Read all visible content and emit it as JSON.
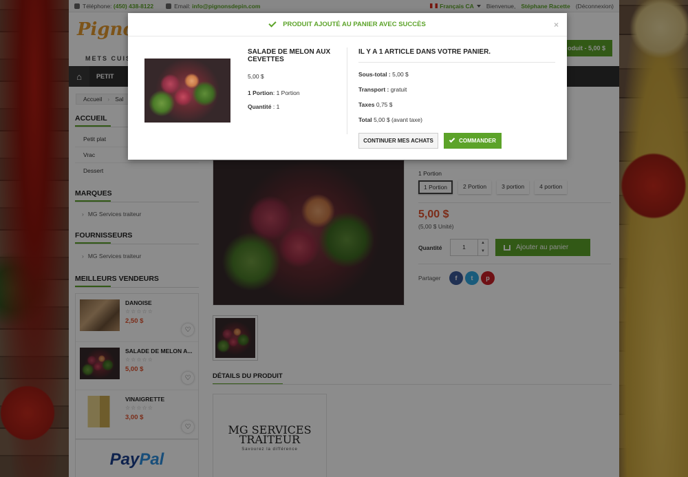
{
  "topbar": {
    "phone_label": "Téléphone:",
    "phone": "(450) 438-8122",
    "email_label": "Email:",
    "email": "info@pignonsdepin.com",
    "language": "Français CA",
    "welcome": "Bienvenue,",
    "user": "Stéphane Racette",
    "logout": "(Déconnexion)"
  },
  "header": {
    "logo": "Pignon",
    "logo_sub": "METS CUIS",
    "cart_button": "oduit - 5,00 $"
  },
  "nav": {
    "home_icon": "home-icon",
    "items": [
      "PETIT"
    ]
  },
  "breadcrumb": [
    "Accueil",
    "Sal"
  ],
  "sidebar": {
    "categories_title": "ACCUEIL",
    "categories": [
      "Petit plat",
      "Vrac",
      "Dessert"
    ],
    "brands_title": "MARQUES",
    "brands": [
      "MG Services traiteur"
    ],
    "suppliers_title": "FOURNISSEURS",
    "suppliers": [
      "MG Services traiteur"
    ],
    "bestsellers_title": "MEILLEURS VENDEURS",
    "bestsellers": [
      {
        "name": "DANOISE",
        "stars": "☆☆☆☆☆",
        "price": "2,50 $"
      },
      {
        "name": "SALADE DE MELON A...",
        "stars": "☆☆☆☆☆",
        "price": "5,00 $"
      },
      {
        "name": "VINAIGRETTE",
        "stars": "☆☆☆☆☆",
        "price": "3,00 $"
      }
    ],
    "paypal": [
      "Pay",
      "Pal"
    ]
  },
  "product": {
    "variant_label": "1 Portion",
    "variants": [
      "1 Portion",
      "2 Portion",
      "3 portion",
      "4 portion"
    ],
    "selected_variant": "1 Portion",
    "price": "5,00 $",
    "unit_price": "(5,00 $ Unité)",
    "quantity_label": "Quantité",
    "quantity": "1",
    "add_to_cart": "Ajouter au panier",
    "share_label": "Partager",
    "share": [
      {
        "name": "facebook",
        "glyph": "f",
        "color": "#3b5998"
      },
      {
        "name": "twitter",
        "glyph": "t",
        "color": "#2ea7e0"
      },
      {
        "name": "pinterest",
        "glyph": "p",
        "color": "#cb2027"
      }
    ],
    "details_title": "DÉTAILS DU PRODUIT",
    "brand_logo_name": "MG SERVICES TRAITEUR",
    "brand_logo_tag": "Savourez la différence"
  },
  "modal": {
    "title": "PRODUIT AJOUTÉ AU PANIER AVEC SUCCÈS",
    "close": "×",
    "product_name": "SALADE DE MELON AUX CEVETTES",
    "product_price": "5,00 $",
    "portion_label": "1 Portion",
    "portion_value": ": 1 Portion",
    "quantity_label": "Quantité",
    "quantity_value": ": 1",
    "cart_title": "IL Y A 1 ARTICLE DANS VOTRE PANIER.",
    "subtotal_label": "Sous-total :",
    "subtotal": "5,00 $",
    "shipping_label": "Transport :",
    "shipping": "gratuit",
    "taxes_label": "Taxes",
    "taxes": "0,75 $",
    "total_label": "Total",
    "total": "5,00 $ (avant taxe)",
    "continue_button": "CONTINUER MES ACHATS",
    "order_button": "COMMANDER"
  },
  "colors": {
    "accent": "#5ca329",
    "price": "#e0502d",
    "nav": "#2e2e2e"
  }
}
